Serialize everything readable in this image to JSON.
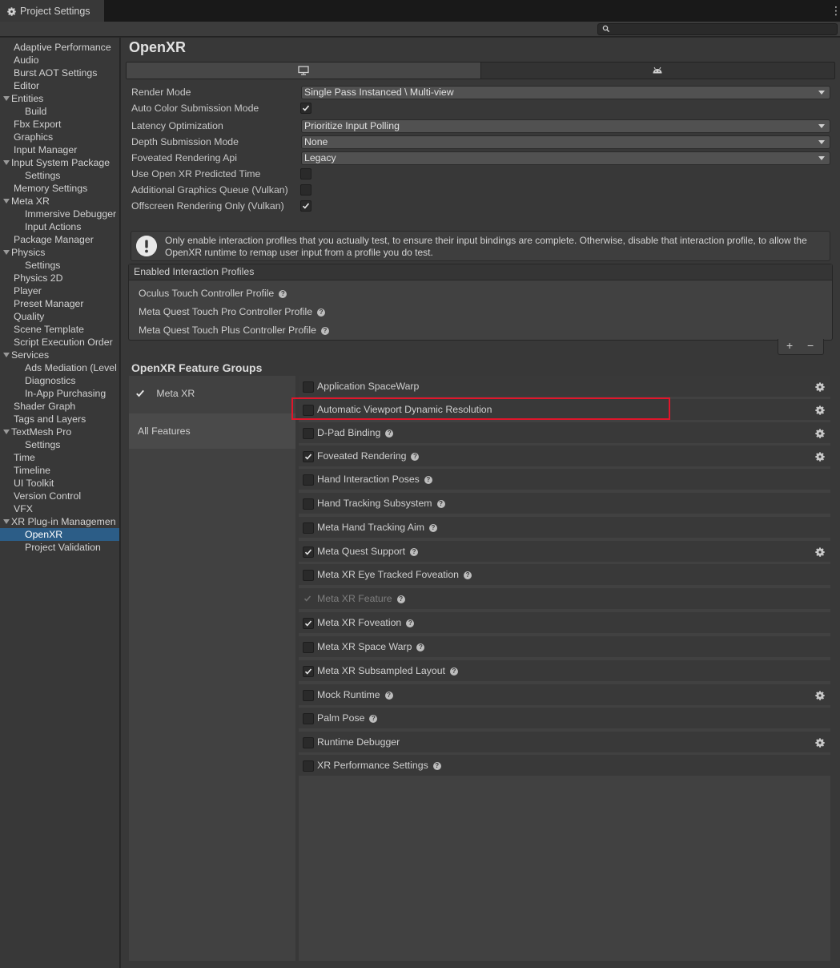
{
  "window": {
    "tab_title": "Project Settings"
  },
  "sidebar": {
    "items": [
      {
        "label": "Adaptive Performance",
        "indent": 0
      },
      {
        "label": "Audio",
        "indent": 0
      },
      {
        "label": "Burst AOT Settings",
        "indent": 0
      },
      {
        "label": "Editor",
        "indent": 0
      },
      {
        "label": "Entities",
        "indent": 0,
        "foldout": true
      },
      {
        "label": "Build",
        "indent": 1
      },
      {
        "label": "Fbx Export",
        "indent": 0
      },
      {
        "label": "Graphics",
        "indent": 0
      },
      {
        "label": "Input Manager",
        "indent": 0
      },
      {
        "label": "Input System Package",
        "indent": 0,
        "foldout": true
      },
      {
        "label": "Settings",
        "indent": 1
      },
      {
        "label": "Memory Settings",
        "indent": 0
      },
      {
        "label": "Meta XR",
        "indent": 0,
        "foldout": true
      },
      {
        "label": "Immersive Debugger",
        "indent": 1
      },
      {
        "label": "Input Actions",
        "indent": 1
      },
      {
        "label": "Package Manager",
        "indent": 0
      },
      {
        "label": "Physics",
        "indent": 0,
        "foldout": true
      },
      {
        "label": "Settings",
        "indent": 1
      },
      {
        "label": "Physics 2D",
        "indent": 0
      },
      {
        "label": "Player",
        "indent": 0
      },
      {
        "label": "Preset Manager",
        "indent": 0
      },
      {
        "label": "Quality",
        "indent": 0
      },
      {
        "label": "Scene Template",
        "indent": 0
      },
      {
        "label": "Script Execution Order",
        "indent": 0
      },
      {
        "label": "Services",
        "indent": 0,
        "foldout": true
      },
      {
        "label": "Ads Mediation (Level",
        "indent": 1
      },
      {
        "label": "Diagnostics",
        "indent": 1
      },
      {
        "label": "In-App Purchasing",
        "indent": 1
      },
      {
        "label": "Shader Graph",
        "indent": 0
      },
      {
        "label": "Tags and Layers",
        "indent": 0
      },
      {
        "label": "TextMesh Pro",
        "indent": 0,
        "foldout": true
      },
      {
        "label": "Settings",
        "indent": 1
      },
      {
        "label": "Time",
        "indent": 0
      },
      {
        "label": "Timeline",
        "indent": 0
      },
      {
        "label": "UI Toolkit",
        "indent": 0
      },
      {
        "label": "Version Control",
        "indent": 0
      },
      {
        "label": "VFX",
        "indent": 0
      },
      {
        "label": "XR Plug-in Managemen",
        "indent": 0,
        "foldout": true
      },
      {
        "label": "OpenXR",
        "indent": 1,
        "selected": true
      },
      {
        "label": "Project Validation",
        "indent": 1
      }
    ]
  },
  "main": {
    "title": "OpenXR",
    "platform_tabs": [
      {
        "icon": "desktop-icon",
        "active": true
      },
      {
        "icon": "android-icon",
        "active": false
      }
    ],
    "settings": {
      "render_mode": {
        "label": "Render Mode",
        "value": "Single Pass Instanced \\ Multi-view"
      },
      "auto_color": {
        "label": "Auto Color Submission Mode",
        "checked": true
      },
      "latency": {
        "label": "Latency Optimization",
        "value": "Prioritize Input Polling"
      },
      "depth": {
        "label": "Depth Submission Mode",
        "value": "None"
      },
      "foveated_api": {
        "label": "Foveated Rendering Api",
        "value": "Legacy"
      },
      "predicted_time": {
        "label": "Use Open XR Predicted Time",
        "checked": false
      },
      "graphics_queue": {
        "label": "Additional Graphics Queue (Vulkan)",
        "checked": false
      },
      "offscreen": {
        "label": "Offscreen Rendering Only (Vulkan)",
        "checked": true
      }
    },
    "help_message": "Only enable interaction profiles that you actually test, to ensure their input bindings are complete. Otherwise, disable that interaction profile, to allow the OpenXR runtime to remap user input from a profile you do test.",
    "profiles": {
      "header": "Enabled Interaction Profiles",
      "items": [
        "Oculus Touch Controller Profile",
        "Meta Quest Touch Pro Controller Profile",
        "Meta Quest Touch Plus Controller Profile"
      ],
      "add_label": "+",
      "remove_label": "−"
    },
    "feature_groups": {
      "title": "OpenXR Feature Groups",
      "groups": [
        {
          "label": "Meta XR",
          "checked": true
        },
        {
          "label": "All Features"
        }
      ]
    },
    "features": [
      {
        "label": "Application SpaceWarp",
        "checked": false,
        "help": false,
        "gear": true
      },
      {
        "label": "Automatic Viewport Dynamic Resolution",
        "checked": false,
        "help": false,
        "gear": true
      },
      {
        "label": "D-Pad Binding",
        "checked": false,
        "help": true,
        "gear": true
      },
      {
        "label": "Foveated Rendering",
        "checked": true,
        "help": true,
        "gear": true
      },
      {
        "label": "Hand Interaction Poses",
        "checked": false,
        "help": true,
        "gear": false
      },
      {
        "label": "Hand Tracking Subsystem",
        "checked": false,
        "help": true,
        "gear": false
      },
      {
        "label": "Meta Hand Tracking Aim",
        "checked": false,
        "help": true,
        "gear": false
      },
      {
        "label": "Meta Quest Support",
        "checked": true,
        "help": true,
        "gear": true
      },
      {
        "label": "Meta XR Eye Tracked Foveation",
        "checked": false,
        "help": true,
        "gear": false
      },
      {
        "label": "Meta XR Feature",
        "checked": true,
        "help": true,
        "gear": false,
        "disabled": true
      },
      {
        "label": "Meta XR Foveation",
        "checked": true,
        "help": true,
        "gear": false
      },
      {
        "label": "Meta XR Space Warp",
        "checked": false,
        "help": true,
        "gear": false
      },
      {
        "label": "Meta XR Subsampled Layout",
        "checked": true,
        "help": true,
        "gear": false
      },
      {
        "label": "Mock Runtime",
        "checked": false,
        "help": true,
        "gear": true
      },
      {
        "label": "Palm Pose",
        "checked": false,
        "help": true,
        "gear": false
      },
      {
        "label": "Runtime Debugger",
        "checked": false,
        "help": false,
        "gear": true
      },
      {
        "label": "XR Performance Settings",
        "checked": false,
        "help": true,
        "gear": false
      }
    ]
  },
  "colors": {
    "selection": "#2c5d87",
    "highlight_box": "#e0162b"
  }
}
